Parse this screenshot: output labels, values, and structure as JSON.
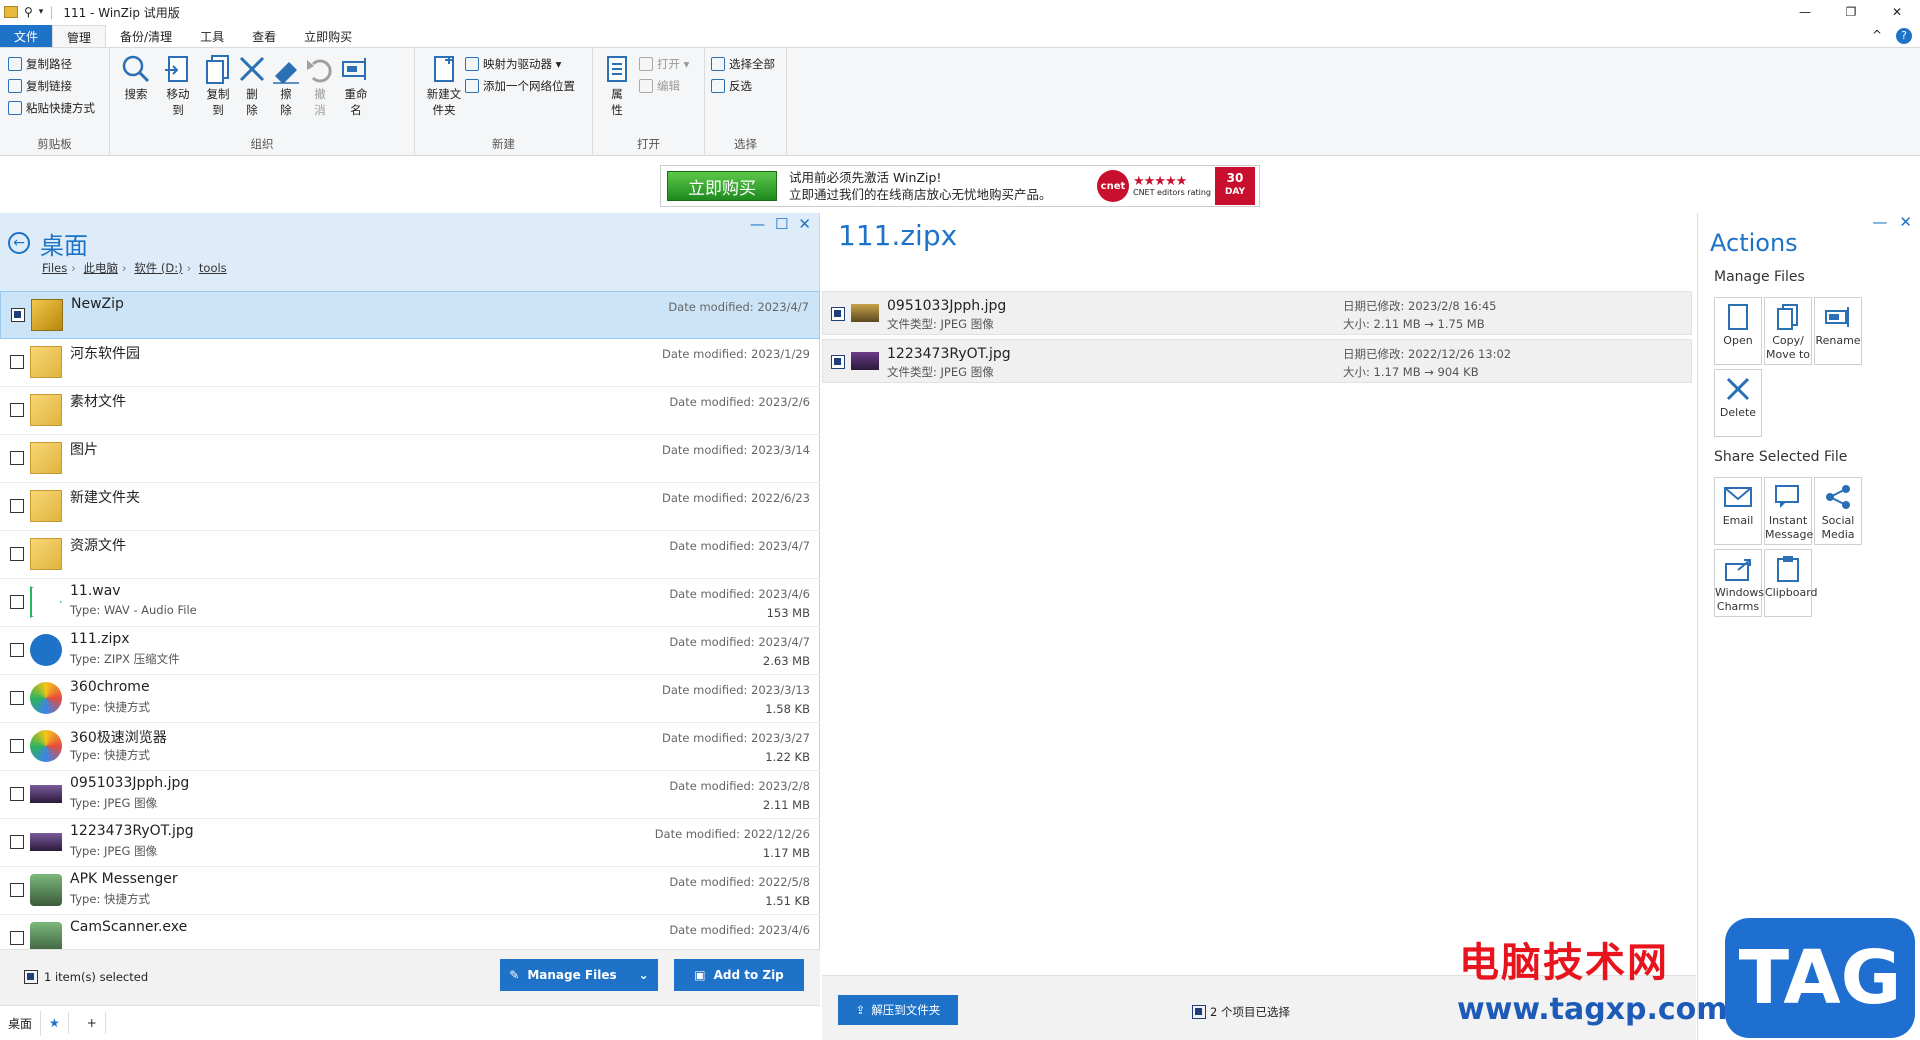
{
  "titlebar": {
    "title": "111 - WinZip 试用版",
    "minimize": "—",
    "maximize": "❐",
    "close": "✕"
  },
  "ribbon_tabs": [
    {
      "label": "文件",
      "kind": "file"
    },
    {
      "label": "管理",
      "kind": "active"
    },
    {
      "label": "备份/清理",
      "kind": ""
    },
    {
      "label": "工具",
      "kind": ""
    },
    {
      "label": "查看",
      "kind": ""
    },
    {
      "label": "立即购买",
      "kind": ""
    }
  ],
  "ribbon_right": {
    "collapse": "^",
    "help": "?"
  },
  "clipboard": {
    "copy_path": "复制路径",
    "copy_link": "复制链接",
    "paste_shortcut": "粘贴快捷方式",
    "label": "剪贴板"
  },
  "organize": {
    "search": "搜索",
    "move_to_1": "移动",
    "move_to_2": "到",
    "copy_to_1": "复制",
    "copy_to_2": "到",
    "delete_1": "删",
    "delete_2": "除",
    "erase_1": "擦",
    "erase_2": "除",
    "undo_1": "撤",
    "undo_2": "消",
    "rename_1": "重命",
    "rename_2": "名",
    "label": "组织"
  },
  "newgroup": {
    "new_folder_1": "新建文",
    "new_folder_2": "件夹",
    "map_drive": "映射为驱动器 ▾",
    "add_network": "添加一个网络位置",
    "label": "新建"
  },
  "opengroup": {
    "properties_1": "属",
    "properties_2": "性",
    "open": "打开 ▾",
    "edit": "编辑",
    "label": "打开"
  },
  "selectgroup": {
    "select_all": "选择全部",
    "invert": "反选",
    "label": "选择"
  },
  "banner": {
    "buy": "立即购买",
    "line1": "试用前必须先激活 WinZip!",
    "line2": "立即通过我们的在线商店放心无忧地购买产品。",
    "cnet": "cnet",
    "rating": "CNET editors rating",
    "stars": "★★★★★",
    "days": "30",
    "day_label": "DAY"
  },
  "left": {
    "title": "桌面",
    "breadcrumb": [
      "Files",
      "此电脑",
      "软件 (D:)",
      "tools"
    ],
    "min": "—",
    "max": "☐",
    "close": "✕",
    "files": [
      {
        "name": "NewZip",
        "type": "",
        "date": "Date modified: 2023/4/7",
        "size": "",
        "icon": "folder-zip-icon",
        "selected": true
      },
      {
        "name": "河东软件园",
        "type": "",
        "date": "Date modified: 2023/1/29",
        "size": "",
        "icon": "folder-icon",
        "selected": false
      },
      {
        "name": "素材文件",
        "type": "",
        "date": "Date modified: 2023/2/6",
        "size": "",
        "icon": "folder-icon",
        "selected": false
      },
      {
        "name": "图片",
        "type": "",
        "date": "Date modified: 2023/3/14",
        "size": "",
        "icon": "folder-icon",
        "selected": false
      },
      {
        "name": "新建文件夹",
        "type": "",
        "date": "Date modified: 2022/6/23",
        "size": "",
        "icon": "folder-icon",
        "selected": false
      },
      {
        "name": "资源文件",
        "type": "",
        "date": "Date modified: 2023/4/7",
        "size": "",
        "icon": "folder-icon",
        "selected": false
      },
      {
        "name": "11.wav",
        "type": "Type: WAV - Audio File",
        "date": "Date modified: 2023/4/6",
        "size": "153 MB",
        "icon": "audio-file-icon",
        "selected": false
      },
      {
        "name": "111.zipx",
        "type": "Type: ZIPX 压缩文件",
        "date": "Date modified: 2023/4/7",
        "size": "2.63 MB",
        "icon": "zipx-file-icon",
        "selected": false
      },
      {
        "name": "360chrome",
        "type": "Type: 快捷方式",
        "date": "Date modified: 2023/3/13",
        "size": "1.58 KB",
        "icon": "browser-icon",
        "selected": false
      },
      {
        "name": "360极速浏览器",
        "type": "Type: 快捷方式",
        "date": "Date modified: 2023/3/27",
        "size": "1.22 KB",
        "icon": "browser-icon",
        "selected": false
      },
      {
        "name": "0951033Jpph.jpg",
        "type": "Type: JPEG 图像",
        "date": "Date modified: 2023/2/8",
        "size": "2.11 MB",
        "icon": "image-thumb-icon",
        "selected": false
      },
      {
        "name": "1223473RyOT.jpg",
        "type": "Type: JPEG 图像",
        "date": "Date modified: 2022/12/26",
        "size": "1.17 MB",
        "icon": "image-thumb-icon",
        "selected": false
      },
      {
        "name": "APK Messenger",
        "type": "Type: 快捷方式",
        "date": "Date modified: 2022/5/8",
        "size": "1.51 KB",
        "icon": "app-icon",
        "selected": false
      },
      {
        "name": "CamScanner.exe",
        "type": "",
        "date": "Date modified: 2023/4/6",
        "size": "",
        "icon": "app-icon",
        "selected": false
      }
    ],
    "selected_count": "1 item(s) selected",
    "manage_files": "Manage Files",
    "add_to_zip": "Add to Zip",
    "tab_desktop": "桌面",
    "tab_pin": "★",
    "tab_add": "+"
  },
  "middle": {
    "title": "111.zipx",
    "rows": [
      {
        "name": "0951033Jpph.jpg",
        "type": "文件类型: JPEG 图像",
        "date": "日期已修改: 2023/2/8 16:45",
        "size": "大小: 2.11 MB → 1.75 MB"
      },
      {
        "name": "1223473RyOT.jpg",
        "type": "文件类型: JPEG 图像",
        "date": "日期已修改: 2022/12/26 13:02",
        "size": "大小: 1.17 MB → 904 KB"
      }
    ],
    "extract": "解压到文件夹",
    "selected": "2 个项目已选择"
  },
  "actions": {
    "title": "Actions",
    "min": "—",
    "close": "✕",
    "manage_label": "Manage Files",
    "open": "Open",
    "copy_move_1": "Copy/",
    "copy_move_2": "Move to",
    "rename": "Rename",
    "delete": "Delete",
    "share_label": "Share Selected File",
    "email": "Email",
    "instant_1": "Instant",
    "instant_2": "Message",
    "social_1": "Social",
    "social_2": "Media",
    "charms_1": "Windows",
    "charms_2": "Charms",
    "clipboard": "Clipboard"
  },
  "watermark": {
    "cn": "电脑技术网",
    "url": "www.tagxp.com",
    "tag": "TAG"
  },
  "colors": {
    "accent": "#1e73c8",
    "selection": "#cce4f7",
    "ribbon": "#f5f6f7"
  }
}
